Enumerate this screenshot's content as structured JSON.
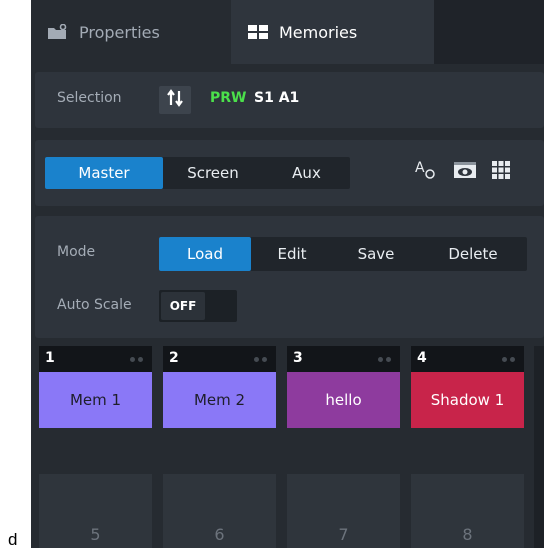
{
  "stray_char": "d",
  "tabs": [
    {
      "label": "Properties",
      "icon": "folder-settings-icon",
      "active": false
    },
    {
      "label": "Memories",
      "icon": "grid-layout-icon",
      "active": true
    }
  ],
  "selection": {
    "label": "Selection",
    "swap_icon": "swap-arrows-icon",
    "target": "PRW",
    "target_color": "#4be04b",
    "slot": "S1 A1"
  },
  "bus": {
    "buttons": [
      "Master",
      "Screen",
      "Aux"
    ],
    "active": "Master",
    "tools": [
      "text-style-icon",
      "preview-eye-icon",
      "grid-icon"
    ]
  },
  "mode": {
    "label": "Mode",
    "buttons": [
      "Load",
      "Edit",
      "Save",
      "Delete"
    ],
    "active": "Load"
  },
  "auto_scale": {
    "label": "Auto Scale",
    "value": "OFF"
  },
  "memories": [
    {
      "number": "1",
      "name": "Mem 1",
      "color": "#8a78f7",
      "text_color": "#1e1e2a"
    },
    {
      "number": "2",
      "name": "Mem 2",
      "color": "#8a78f7",
      "text_color": "#1e1e2a"
    },
    {
      "number": "3",
      "name": "hello",
      "color": "#8e3b9e",
      "text_color": "#ffffff"
    },
    {
      "number": "4",
      "name": "Shadow 1",
      "color": "#c8244a",
      "text_color": "#ffffff"
    }
  ],
  "empty_slots": [
    "5",
    "6",
    "7",
    "8"
  ],
  "colors": {
    "accent": "#1a82cc",
    "panel_bg": "#262b31"
  }
}
